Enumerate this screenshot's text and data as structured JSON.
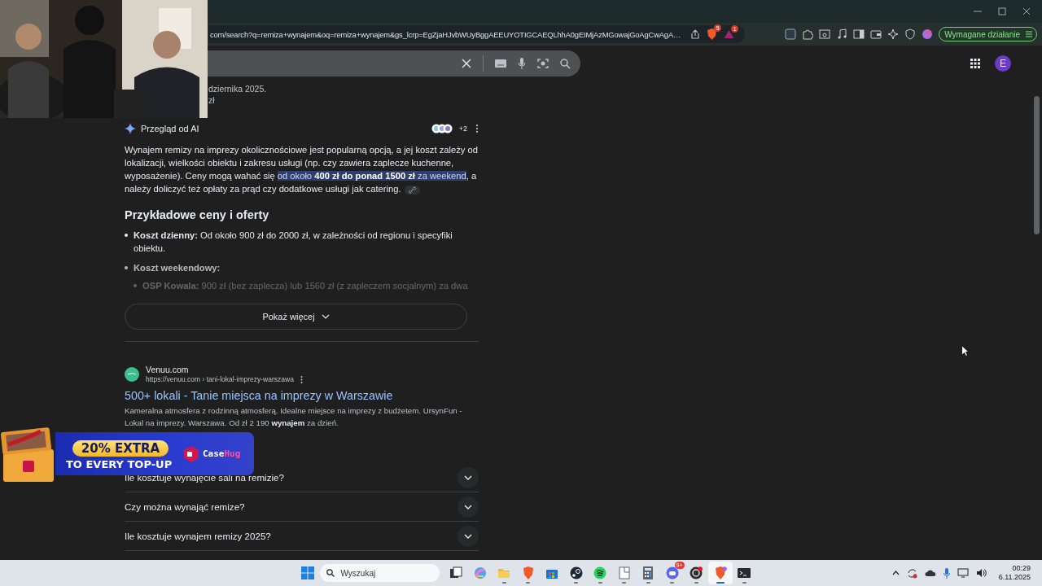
{
  "browser": {
    "url": "com/search?q=remiza+wynajem&oq=remiza+wynajem&gs_lcrp=EgZjaHJvbWUyBggAEEUYOTIGCAEQLhhA0gEIMjAzMGowajGoAgCwAgA…",
    "shield_badge": "5",
    "alert_badge": "1",
    "action_button": "Wymagane działanie"
  },
  "search": {
    "avatar": "E"
  },
  "snippet_lines": [
    "dziernika 2025.",
    "zł"
  ],
  "ai_overview": {
    "title": "Przegląd od AI",
    "sources_more": "+2",
    "paragraph": {
      "before": "Wynajem remizy na imprezy okolicznościowe jest popularną opcją, a jej koszt zależy od lokalizacji, wielkości obiektu i zakresu usługi (np. czy zawiera zaplecze kuchenne, wyposażenie). Ceny mogą wahać się ",
      "highlight": "od około **400 zł do ponad 1500 zł** za weekend",
      "after": ", a należy doliczyć też opłaty za prąd czy dodatkowe usługi jak catering."
    },
    "heading": "Przykładowe ceny i oferty",
    "bullets": [
      {
        "label": "Koszt dzienny:",
        "text": "Od około 900 zł do 2000 zł, w zależności od regionu i specyfiki obiektu."
      },
      {
        "label": "Koszt weekendowy:",
        "children": [
          {
            "label": "OSP Kowala:",
            "text": "900 zł (bez zaplecza) lub 1560 zł (z zapleczem socjalnym) za dwa"
          }
        ]
      }
    ],
    "show_more": "Pokaż więcej"
  },
  "result": {
    "site": "Venuu.com",
    "url": "https://venuu.com › tani-lokal-imprezy-warszawa",
    "title": "500+ lokali - Tanie miejsca na imprezy w Warszawie",
    "snippet": "Kameralna atmosfera z rodzinną atmosferą. Idealne miejsce na imprezy z budżetem. UrsynFun - Lokal na imprezy. Warszawa. Od zł 2 190 **wynajem** za dzień."
  },
  "questions": [
    "Ile kosztuje wynajęcie sali na remizie?",
    "Czy można wynająć remize?",
    "Ile kosztuje wynajem remizy 2025?"
  ],
  "ad": {
    "headline": "20% EXTRA",
    "subline": "TO EVERY TOP-UP",
    "brand": {
      "first": "Case",
      "second": "Hug"
    }
  },
  "taskbar": {
    "search_placeholder": "Wyszukaj",
    "apps": [
      {
        "running": false,
        "selected": false
      },
      {
        "running": false,
        "selected": false
      },
      {
        "running": true,
        "selected": false
      },
      {
        "running": true,
        "selected": false
      },
      {
        "running": false,
        "selected": false
      },
      {
        "running": true,
        "selected": false
      },
      {
        "running": true,
        "selected": false
      },
      {
        "running": true,
        "selected": false
      },
      {
        "running": true,
        "selected": false
      },
      {
        "running": true,
        "selected": false,
        "badge": "9+"
      },
      {
        "running": true,
        "selected": false
      },
      {
        "running": true,
        "selected": true
      },
      {
        "running": true,
        "selected": false
      }
    ],
    "clock": {
      "time": "00:29",
      "date": "6.11.2025"
    }
  }
}
